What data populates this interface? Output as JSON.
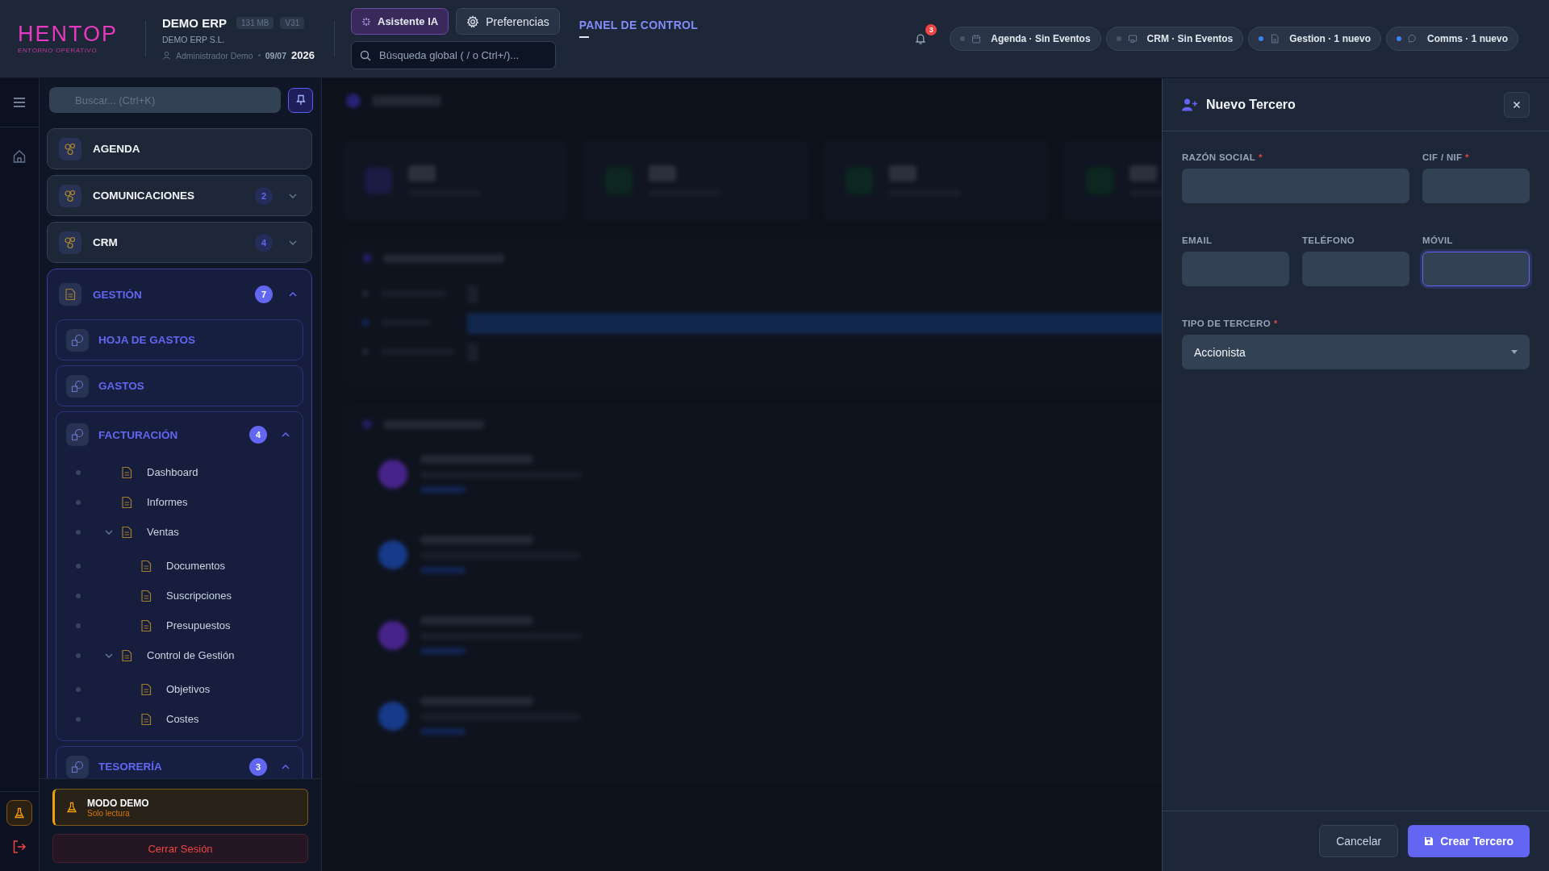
{
  "brand": {
    "logo": "HENTOP",
    "tagline": "ENTORNO OPERATIVO"
  },
  "company": {
    "name": "DEMO ERP",
    "memory": "131 MB",
    "version": "V31",
    "legal_name": "DEMO ERP S.L.",
    "user": "Administrador Demo",
    "date": "09/07",
    "year": "2026"
  },
  "header_actions": [
    {
      "label": "Asistente IA",
      "kind": "ai",
      "selected": true
    },
    {
      "label": "Preferencias",
      "kind": "settings",
      "selected": false
    }
  ],
  "global_search": {
    "placeholder": "Búsqueda global ( / o Ctrl+/)..."
  },
  "page_title": "PANEL DE CONTROL",
  "notifications": {
    "count": "3"
  },
  "status_chips": [
    {
      "label": "Agenda · Sin Eventos",
      "kind": "calendar",
      "new": false
    },
    {
      "label": "CRM · Sin Eventos",
      "kind": "monitor",
      "new": false
    },
    {
      "label": "Gestion · 1 nuevo",
      "kind": "document",
      "new": true
    },
    {
      "label": "Comms · 1 nuevo",
      "kind": "chat",
      "new": true
    }
  ],
  "sidebar": {
    "search": {
      "placeholder": "Buscar... (Ctrl+K)"
    },
    "items": [
      {
        "label": "AGENDA",
        "selected": false
      },
      {
        "label": "COMUNICACIONES",
        "badge": "2",
        "expanded": false,
        "selected": false
      },
      {
        "label": "CRM",
        "badge": "4",
        "expanded": false,
        "selected": false
      },
      {
        "label": "GESTIÓN",
        "badge": "7",
        "expanded": true,
        "selected": true,
        "children": [
          {
            "label": "HOJA DE GASTOS"
          },
          {
            "label": "GASTOS"
          },
          {
            "label": "FACTURACIÓN",
            "badge": "4",
            "expanded": true,
            "children": [
              {
                "label": "Dashboard"
              },
              {
                "label": "Informes"
              },
              {
                "label": "Ventas",
                "expanded": true,
                "children": [
                  {
                    "label": "Documentos"
                  },
                  {
                    "label": "Suscripciones"
                  },
                  {
                    "label": "Presupuestos"
                  }
                ]
              },
              {
                "label": "Control de Gestión",
                "expanded": true,
                "children": [
                  {
                    "label": "Objetivos"
                  },
                  {
                    "label": "Costes"
                  }
                ]
              }
            ]
          },
          {
            "label": "TESORERÍA",
            "badge": "3",
            "expanded": true
          }
        ]
      }
    ]
  },
  "demo_mode": {
    "title": "MODO DEMO",
    "subtitle": "Solo lectura"
  },
  "logout": "Cerrar Sesión",
  "dialog": {
    "title": "Nuevo Tercero",
    "fields": [
      {
        "label": "RAZÓN SOCIAL",
        "required_mark": "*",
        "kind": "text",
        "focused": false
      },
      {
        "label": "CIF / NIF",
        "required_mark": "*",
        "kind": "text",
        "focused": false
      },
      {
        "label": "EMAIL",
        "kind": "text",
        "focused": false
      },
      {
        "label": "TELÉFONO",
        "kind": "text",
        "focused": false
      },
      {
        "label": "MÓVIL",
        "kind": "text",
        "focused": true
      },
      {
        "label": "TIPO DE TERCERO",
        "required_mark": "*",
        "kind": "select",
        "value": "Accionista"
      }
    ],
    "buttons": [
      {
        "label": "Cancelar",
        "kind": "secondary"
      },
      {
        "label": "Crear Tercero",
        "kind": "primary"
      }
    ]
  }
}
